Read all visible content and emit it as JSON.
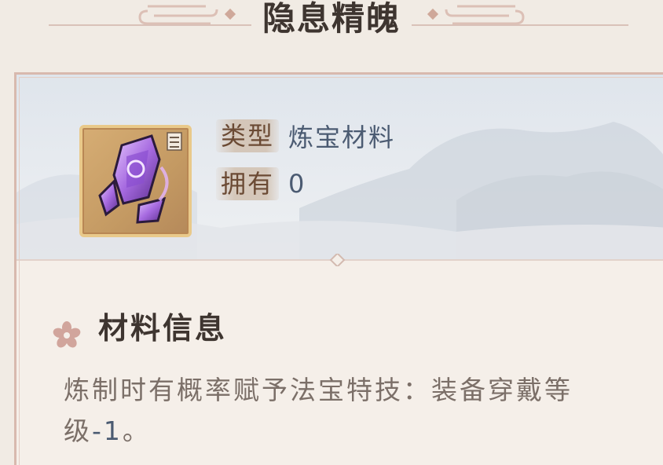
{
  "item": {
    "name": "隐息精魄",
    "type_label": "类型",
    "type_value": "炼宝材料",
    "owned_label": "拥有",
    "owned_value": "0"
  },
  "section": {
    "title": "材料信息",
    "description_text": "炼制时有概率赋予法宝特技：装备穿戴等级",
    "description_value": "-1",
    "description_end": "。"
  },
  "icons": {
    "item_icon": "purple-crystal-shard-icon",
    "section_icon": "flower-icon"
  },
  "colors": {
    "title": "#3e3530",
    "label": "#6b4a34",
    "value": "#4b5b72",
    "description": "#7b6f68",
    "card_border": "#d8b9ae"
  }
}
